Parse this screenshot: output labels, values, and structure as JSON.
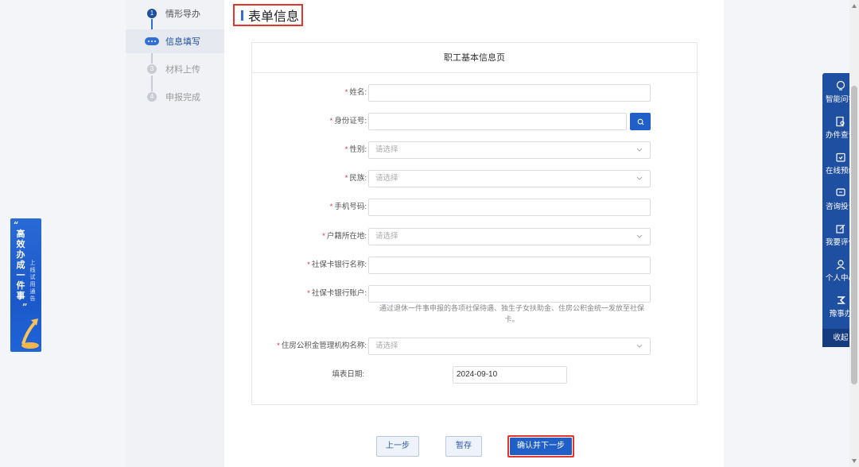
{
  "promo": {
    "quote_open": "“",
    "headline": "高效办成一件事",
    "sub": "上线试用通告",
    "quote_close": "”"
  },
  "steps": [
    {
      "num": "1",
      "label": "情形导办",
      "state": "done"
    },
    {
      "num": "",
      "label": "信息填写",
      "state": "active"
    },
    {
      "num": "3",
      "label": "材料上传",
      "state": "todo"
    },
    {
      "num": "4",
      "label": "申报完成",
      "state": "todo"
    }
  ],
  "page": {
    "title": "表单信息"
  },
  "form": {
    "heading": "职工基本信息页",
    "fields": {
      "name": {
        "label": "姓名:",
        "value": ""
      },
      "id_number": {
        "label": "身份证号:",
        "value": ""
      },
      "gender": {
        "label": "性别:",
        "placeholder": "请选择"
      },
      "ethnicity": {
        "label": "民族:",
        "placeholder": "请选择"
      },
      "phone": {
        "label": "手机号码:",
        "value": ""
      },
      "hukou": {
        "label": "户籍所在地:",
        "placeholder": "请选择"
      },
      "bank_name": {
        "label": "社保卡银行名称:",
        "value": ""
      },
      "bank_account": {
        "label": "社保卡银行账户:",
        "hint": "通过退休一件事申报的各项社保待遇、独生子女扶助金、住房公积金统一发放至社保卡。"
      },
      "housing_fund_org": {
        "label": "住房公积金管理机构名称:",
        "placeholder": "请选择"
      },
      "fill_date": {
        "label": "填表日期:",
        "value": "2024-09-10"
      }
    },
    "required_mark": "*"
  },
  "buttons": {
    "prev": "上一步",
    "save": "暂存",
    "next": "确认并下一步"
  },
  "right_nav": {
    "items": [
      {
        "label": "智能问答",
        "icon": "bulb-icon"
      },
      {
        "label": "办件查询",
        "icon": "doc-search-icon"
      },
      {
        "label": "在线预约",
        "icon": "calendar-icon"
      },
      {
        "label": "咨询投诉",
        "icon": "chat-icon"
      },
      {
        "label": "我要评价",
        "icon": "edit-icon"
      },
      {
        "label": "个人中心",
        "icon": "user-icon"
      },
      {
        "label": "豫事办",
        "icon": "brand-icon"
      }
    ],
    "collapse": "收起"
  },
  "colors": {
    "accent": "#1f5fc7",
    "nav": "#1f4fa0",
    "highlight": "#e3342f"
  }
}
